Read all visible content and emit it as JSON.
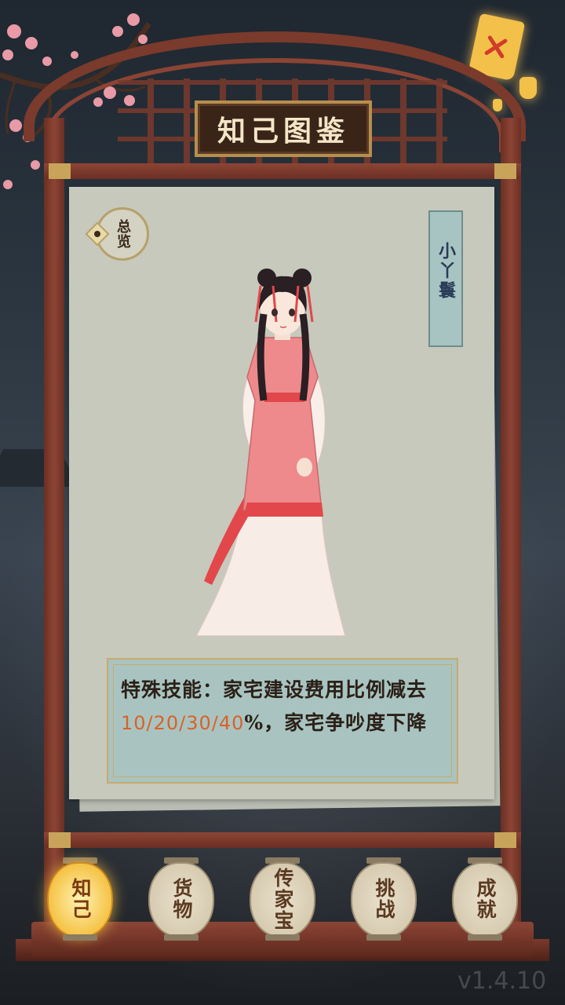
{
  "page": {
    "title": "知己图鉴",
    "version": "v1.4.10"
  },
  "overview_button": {
    "label": "总览"
  },
  "character": {
    "name": "小丫鬟"
  },
  "skill": {
    "prefix": "特殊技能：家宅建设费用比例减去",
    "values": "10/20/30/40",
    "suffix": "%，家宅争吵度下降"
  },
  "tabs": [
    {
      "label": "知己",
      "active": true
    },
    {
      "label": "货物",
      "active": false
    },
    {
      "label": "传家宝",
      "active": false
    },
    {
      "label": "挑战",
      "active": false
    },
    {
      "label": "成就",
      "active": false
    }
  ],
  "colors": {
    "frame": "#7a3a2c",
    "highlight": "#d8622a",
    "skill_bg": "#a9c4c0",
    "active_lantern": "#f5c347"
  },
  "icons": [
    "close-lantern-icon",
    "plum-blossom-branch",
    "person-icon"
  ]
}
